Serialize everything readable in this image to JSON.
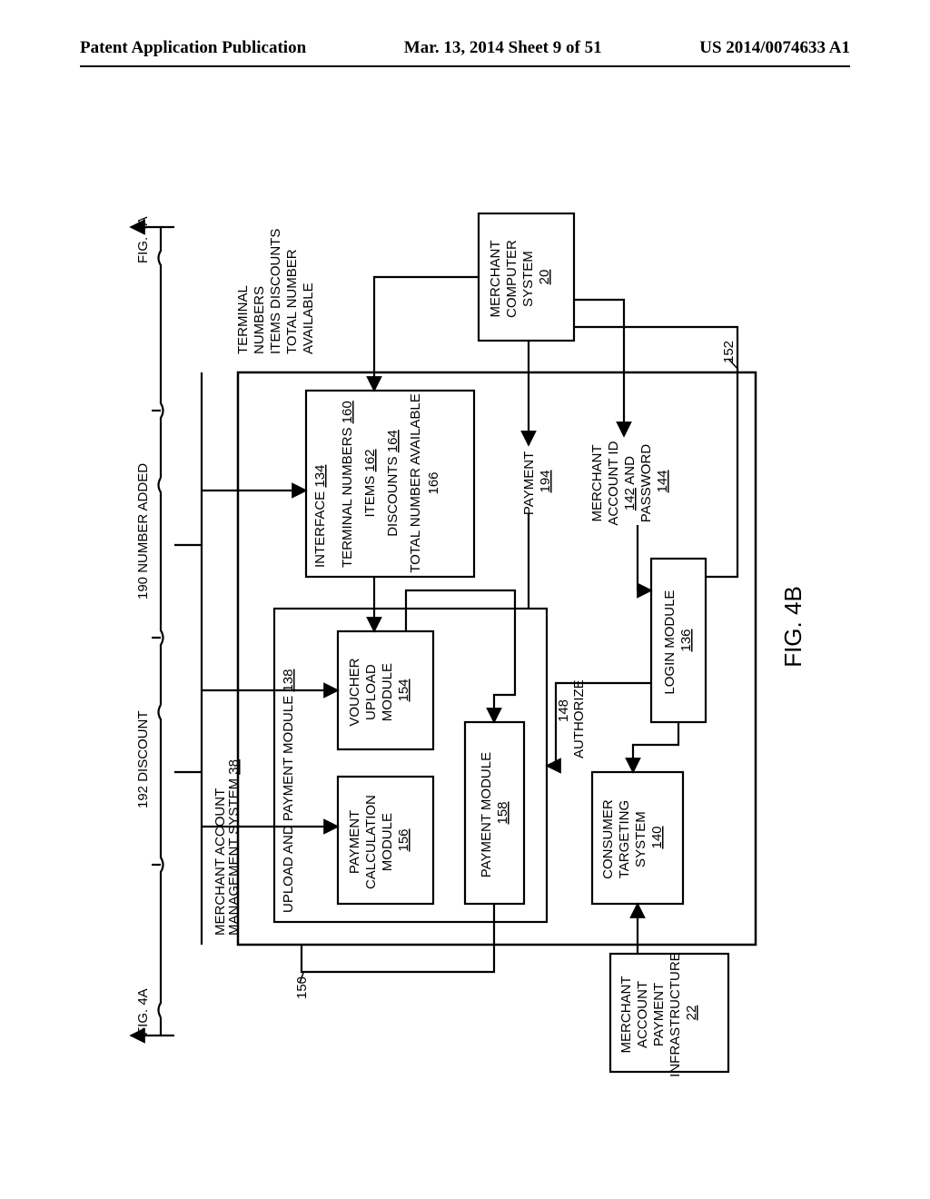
{
  "header": {
    "left": "Patent Application Publication",
    "mid": "Mar. 13, 2014  Sheet 9 of 51",
    "right": "US 2014/0074633 A1"
  },
  "fig": {
    "label": "FIG. 4B",
    "top_ref_left": "FIG. 4A",
    "top_ref_right": "FIG. 4A",
    "above_192": "192 DISCOUNT",
    "above_190": "190 NUMBER ADDED",
    "mams_title": "MERCHANT ACCOUNT",
    "mams_sub": "MANAGEMENT SYSTEM",
    "mams_ref": "38",
    "upm_title": "UPLOAD AND PAYMENT MODULE",
    "upm_ref": "138",
    "pcm_l1": "PAYMENT",
    "pcm_l2": "CALCULATION",
    "pcm_l3": "MODULE",
    "pcm_ref": "156",
    "vum_l1": "VOUCHER",
    "vum_l2": "UPLOAD",
    "vum_l3": "MODULE",
    "vum_ref": "154",
    "pm_l1": "PAYMENT MODULE",
    "pm_ref": "158",
    "cts_l1": "CONSUMER",
    "cts_l2": "TARGETING",
    "cts_l3": "SYSTEM",
    "cts_ref": "140",
    "login_l1": "LOGIN MODULE",
    "login_ref": "136",
    "authorize": "AUTHORIZE",
    "ref148": "148",
    "iface_title": "INTERFACE",
    "iface_ref": "134",
    "tn": "TERMINAL NUMBERS",
    "tn_ref": "160",
    "items": "ITEMS",
    "items_ref": "162",
    "disc": "DISCOUNTS",
    "disc_ref": "164",
    "tna": "TOTAL NUMBER AVAILABLE",
    "tna_ref": "166",
    "payment": "PAYMENT",
    "payment_ref": "194",
    "maid_l1": "MERCHANT",
    "maid_l2": "ACCOUNT ID",
    "maid_ref1": "142",
    "maid_and": "AND",
    "maid_l3": "PASSWORD",
    "maid_ref2": "144",
    "ext_l1": "TERMINAL",
    "ext_l2": "NUMBERS",
    "ext_l3": "ITEMS DISCOUNTS",
    "ext_l4": "TOTAL NUMBER",
    "ext_l5": "AVAILABLE",
    "mcs_l1": "MERCHANT",
    "mcs_l2": "COMPUTER",
    "mcs_l3": "SYSTEM",
    "mcs_ref": "20",
    "mapi_l1": "MERCHANT",
    "mapi_l2": "ACCOUNT",
    "mapi_l3": "PAYMENT",
    "mapi_l4": "INFRASTRUCTURE",
    "mapi_ref": "22",
    "ref150": "150",
    "ref152": "152"
  }
}
